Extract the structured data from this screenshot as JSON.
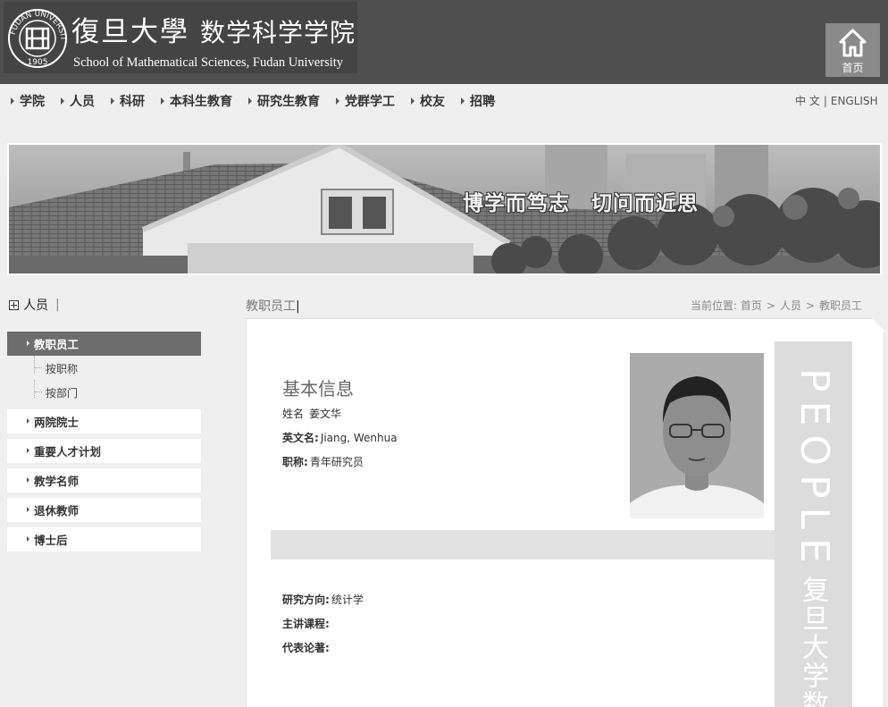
{
  "header": {
    "cn_university": "復旦大學",
    "cn_school": "数学科学学院",
    "en_name": "School of Mathematical Sciences, Fudan University",
    "seal_top_text": "FUDAN UNIVERSITY",
    "seal_year": "1905",
    "home_label": "首页"
  },
  "nav": {
    "items": [
      "学院",
      "人员",
      "科研",
      "本科生教育",
      "研究生教育",
      "党群学工",
      "校友",
      "招聘"
    ],
    "lang_cn": "中 文",
    "lang_sep": "|",
    "lang_en": "ENGLISH"
  },
  "banner": {
    "slogan": "博学而笃志　切问而近思"
  },
  "sidebar": {
    "heading": "人员",
    "heading_bar": "|",
    "items": [
      {
        "label": "教职员工",
        "active": true
      },
      {
        "label": "两院院士"
      },
      {
        "label": "重要人才计划"
      },
      {
        "label": "教学名师"
      },
      {
        "label": "退休教师"
      },
      {
        "label": "博士后"
      }
    ],
    "subitems": [
      "按职称",
      "按部门"
    ]
  },
  "main": {
    "section_title": "教职员工",
    "section_bar": "|",
    "breadcrumb_label": "当前位置:",
    "breadcrumb": [
      "首页",
      "人员",
      "教职员工"
    ],
    "breadcrumb_sep": ">",
    "info_heading": "基本信息",
    "fields": {
      "name_label": "姓名",
      "name_value": "姜文华",
      "en_name_label": "英文名:",
      "en_name_value": "Jiang, Wenhua",
      "title_label": "职称:",
      "title_value": "青年研究员",
      "research_label": "研究方向:",
      "research_value": "统计学",
      "courses_label": "主讲课程:",
      "courses_value": "",
      "papers_label": "代表论著:",
      "papers_value": ""
    },
    "side_strip_en": "PEOPLE",
    "side_strip_cn": "复旦大学数"
  },
  "colors": {
    "header_bg": "#4f4f4f",
    "page_bg": "#efefef",
    "active_item": "#6d6d6d",
    "home_btn": "#8a8a8a",
    "strip": "#dcdcdc"
  }
}
